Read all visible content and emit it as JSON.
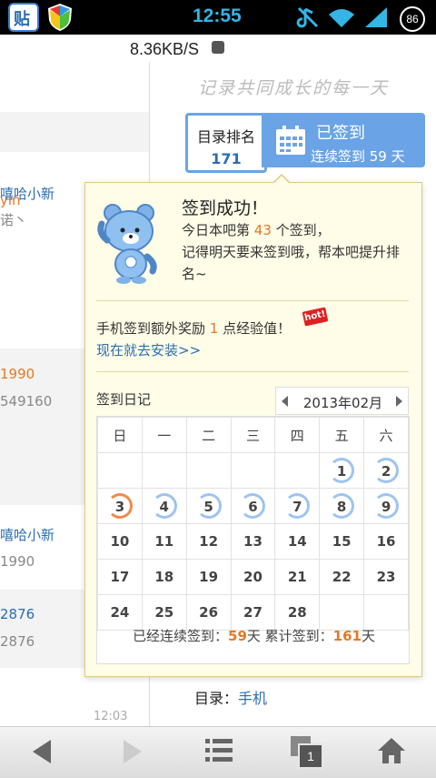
{
  "status": {
    "time": "12:55",
    "battery": "86",
    "app_icon_label": "贴"
  },
  "speed": "8.36KB/S",
  "left_feed": [
    {
      "text": "yin",
      "color": "orange"
    },
    {
      "text": "嘻哈小新",
      "color": "blue"
    },
    {
      "text": "诺丶",
      "color": "grey"
    },
    {
      "text": "1990",
      "color": "orange"
    },
    {
      "text": "549160",
      "color": "grey"
    },
    {
      "text": "嘻哈小新",
      "color": "blue"
    },
    {
      "text": "1990",
      "color": "grey"
    },
    {
      "text": "2876",
      "color": "blue"
    },
    {
      "text": "2876",
      "color": "grey"
    }
  ],
  "nav_time": "12:03",
  "slogan": "记录共同成长的每一天",
  "rank": {
    "label": "目录排名",
    "value": "171"
  },
  "signed": {
    "title": "已签到",
    "subtitle": "连续签到 59 天"
  },
  "popup": {
    "title": "签到成功！",
    "line1_pre": "今日本吧第 ",
    "line1_num": "43",
    "line1_post": " 个签到，",
    "line2": "记得明天要来签到哦，帮本吧提升排",
    "line3": "名~",
    "bonus_pre": "手机签到额外奖励 ",
    "bonus_num": "1",
    "bonus_post": " 点经验值！",
    "hot_badge": "hot!",
    "install_link": "现在就去安装>>",
    "calendar_label": "签到日记",
    "month": "2013年02月"
  },
  "calendar": {
    "weekdays": [
      "日",
      "一",
      "二",
      "三",
      "四",
      "五",
      "六"
    ],
    "weeks": [
      [
        "",
        "",
        "",
        "",
        "",
        "1",
        "2"
      ],
      [
        "3",
        "4",
        "5",
        "6",
        "7",
        "8",
        "9"
      ],
      [
        "10",
        "11",
        "12",
        "13",
        "14",
        "15",
        "16"
      ],
      [
        "17",
        "18",
        "19",
        "20",
        "21",
        "22",
        "23"
      ],
      [
        "24",
        "25",
        "26",
        "27",
        "28",
        "",
        ""
      ]
    ],
    "signed_days": [
      "1",
      "2",
      "3",
      "4",
      "5",
      "6",
      "7",
      "8",
      "9"
    ],
    "today": "3",
    "footer_pre": "已经连续签到：",
    "streak": "59",
    "footer_mid": "天  累计签到：",
    "total": "161",
    "footer_post": "天"
  },
  "category": {
    "label": "目录：",
    "value": "手机"
  },
  "colors": {
    "accent_blue": "#6aa4e6",
    "link_blue": "#2a6db5",
    "highlight_orange": "#e87722",
    "popup_bg": "#fffce7"
  },
  "icons": [
    "tieba-app-icon",
    "shield-icon",
    "mute-icon",
    "wifi-icon",
    "signal-icon",
    "battery-icon",
    "rss-icon",
    "calendar-icon",
    "bear-mascot",
    "back-icon",
    "forward-icon",
    "menu-icon",
    "windows-icon",
    "home-icon"
  ],
  "nav": {
    "windows_count": "1"
  }
}
